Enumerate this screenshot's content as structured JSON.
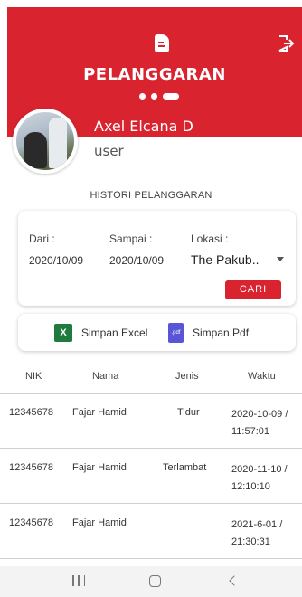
{
  "header": {
    "title": "PELANGGARAN",
    "logo_icon": "document-icon",
    "logout_icon": "logout-icon",
    "accent_color": "#d9232f"
  },
  "profile": {
    "name": "Axel Elcana D",
    "role": "user"
  },
  "section_title": "HISTORI PELANGGARAN",
  "filter": {
    "dari_label": "Dari :",
    "dari_value": "2020/10/09",
    "sampai_label": "Sampai :",
    "sampai_value": "2020/10/09",
    "lokasi_label": "Lokasi :",
    "lokasi_value": "The Pakub..",
    "cari_label": "CARI"
  },
  "export": {
    "excel_label": "Simpan Excel",
    "pdf_label": "Simpan Pdf"
  },
  "table": {
    "columns": [
      "NIK",
      "Nama",
      "Jenis",
      "Waktu"
    ],
    "rows": [
      {
        "nik": "12345678",
        "nama": "Fajar Hamid",
        "jenis": "Tidur",
        "waktu_date": "2020-10-09 /",
        "waktu_time": "11:57:01"
      },
      {
        "nik": "12345678",
        "nama": "Fajar Hamid",
        "jenis": "Terlambat",
        "waktu_date": "2020-11-10 /",
        "waktu_time": "12:10:10"
      },
      {
        "nik": "12345678",
        "nama": "Fajar Hamid",
        "jenis": "",
        "waktu_date": "2021-6-01 /",
        "waktu_time": "21:30:31"
      }
    ]
  }
}
